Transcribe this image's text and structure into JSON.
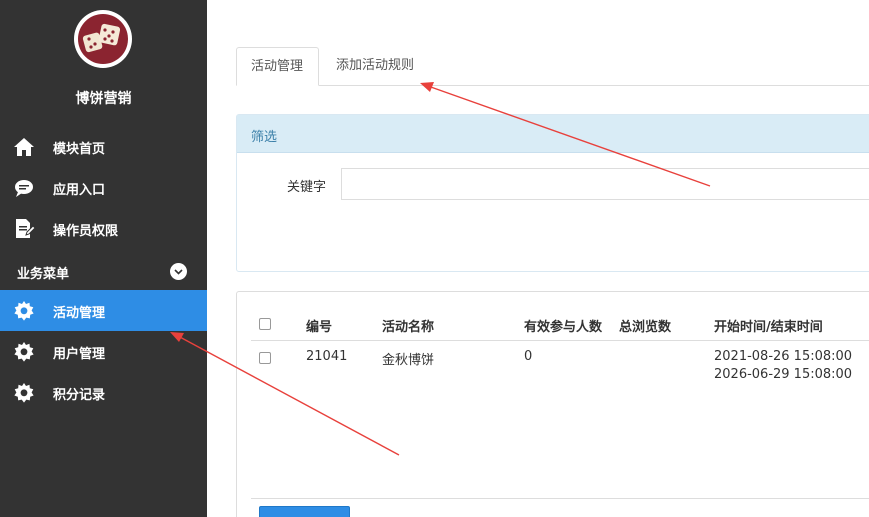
{
  "sidebar": {
    "brand": "博饼营销",
    "items": [
      {
        "label": "模块首页",
        "icon": "home-icon"
      },
      {
        "label": "应用入口",
        "icon": "chat-icon"
      },
      {
        "label": "操作员权限",
        "icon": "document-edit-icon"
      }
    ],
    "group": {
      "label": "业务菜单"
    },
    "sub_items": [
      {
        "label": "活动管理",
        "icon": "gear-icon",
        "active": true
      },
      {
        "label": "用户管理",
        "icon": "gear-icon"
      },
      {
        "label": "积分记录",
        "icon": "gear-icon"
      }
    ],
    "active_color": "#2e8de5",
    "background": "#333333"
  },
  "tabs": [
    {
      "label": "活动管理",
      "active": true
    },
    {
      "label": "添加活动规则",
      "active": false
    }
  ],
  "filter": {
    "title": "筛选",
    "keyword_label": "关键字",
    "keyword_value": ""
  },
  "table": {
    "columns": [
      "编号",
      "活动名称",
      "有效参与人数",
      "总浏览数",
      "开始时间/结束时间"
    ],
    "rows": [
      {
        "id": "21041",
        "name": "金秋博饼",
        "participants": "0",
        "views": "",
        "start": "2021-08-26 15:08:00",
        "end": "2026-06-29 15:08:00"
      }
    ]
  },
  "annotation_color": "#e8413c"
}
